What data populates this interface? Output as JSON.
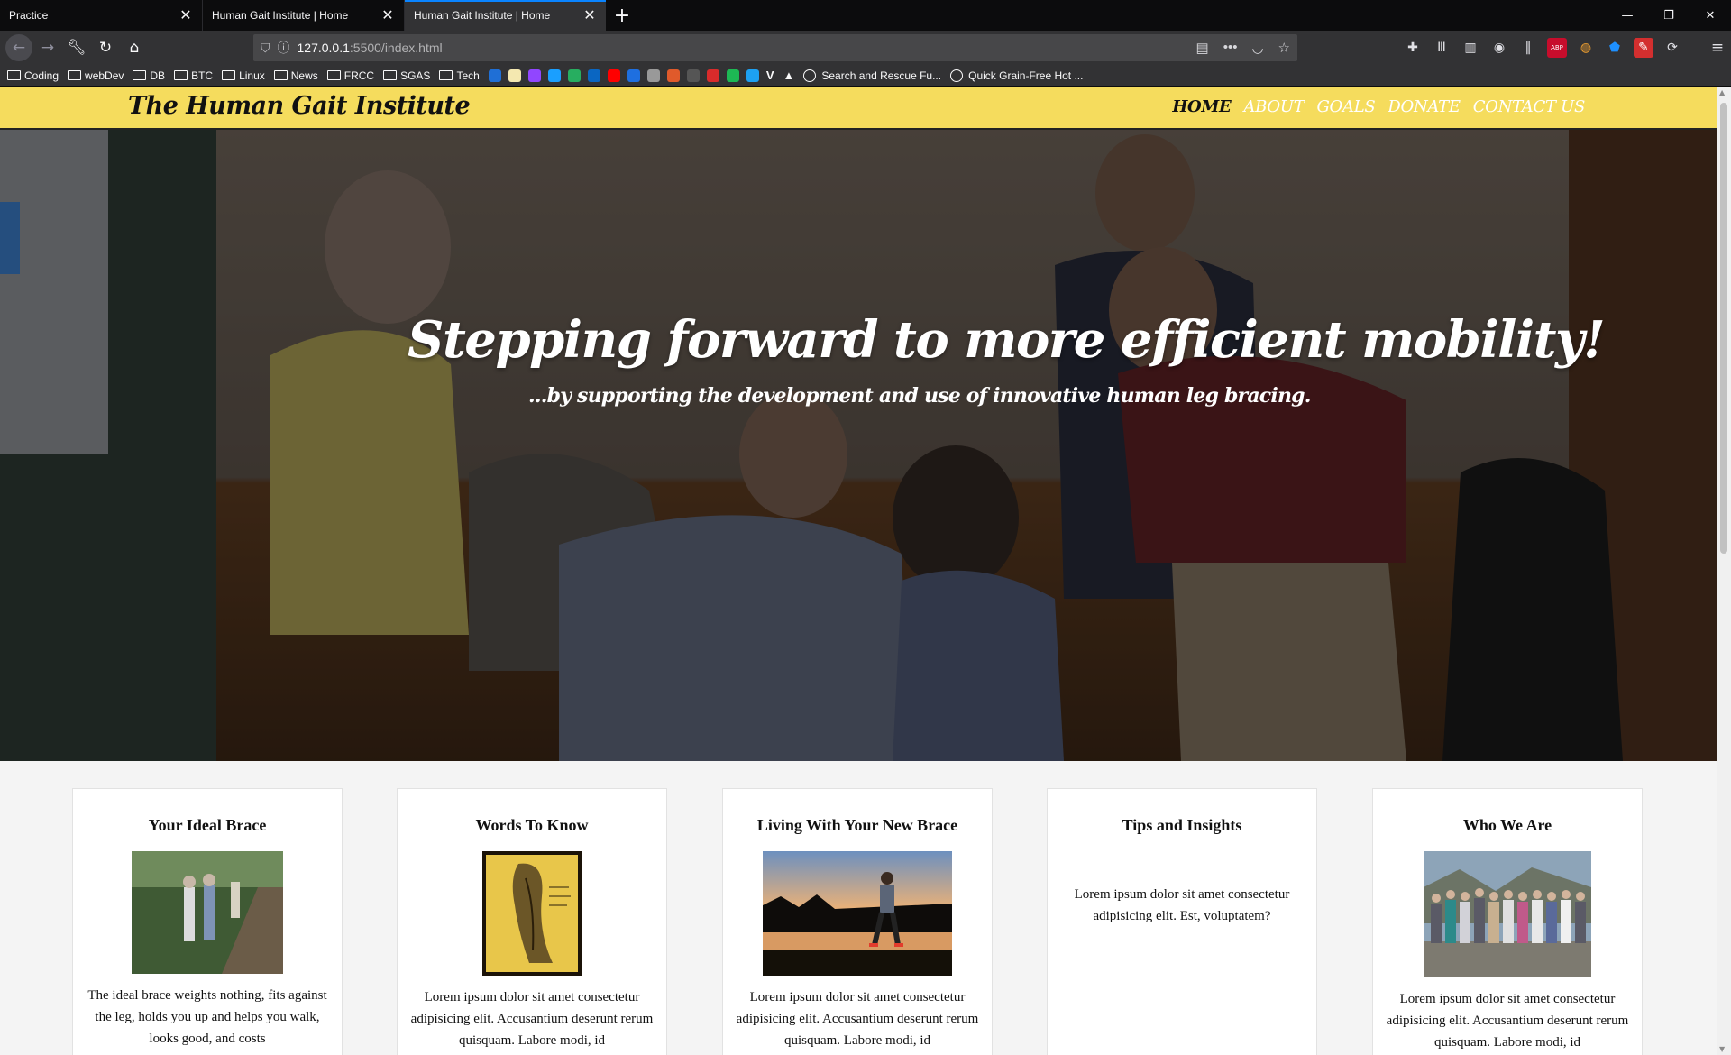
{
  "browser": {
    "tabs": [
      {
        "title": "Practice",
        "active": false
      },
      {
        "title": "Human Gait Institute | Home",
        "active": false
      },
      {
        "title": "Human Gait Institute | Home",
        "active": true
      }
    ],
    "new_tab_symbol": "+",
    "url_host": "127.0.0.1",
    "url_path": ":5500/index.html",
    "bookmarks": [
      {
        "type": "folder",
        "label": "Coding"
      },
      {
        "type": "folder",
        "label": "webDev"
      },
      {
        "type": "folder",
        "label": "DB"
      },
      {
        "type": "folder",
        "label": "BTC"
      },
      {
        "type": "folder",
        "label": "Linux"
      },
      {
        "type": "folder",
        "label": "News"
      },
      {
        "type": "folder",
        "label": "FRCC"
      },
      {
        "type": "folder",
        "label": "SGAS"
      },
      {
        "type": "folder",
        "label": "Tech"
      }
    ],
    "bookmark_favicon_colors": [
      "#1f6fd6",
      "#f4e8b0",
      "#9146ff",
      "#1a9fff",
      "#27ae60",
      "#0a66c2",
      "#ff0000",
      "#1e6fe0",
      "#999999",
      "#e05a2b",
      "#555555",
      "#d92b2b",
      "#1db954",
      "#1da1f2"
    ],
    "bookmark_letter": "V",
    "bookmark_links": [
      {
        "label": "Search and Rescue Fu..."
      },
      {
        "label": "Quick Grain-Free Hot ..."
      }
    ]
  },
  "site": {
    "logo": "The Human Gait Institute",
    "nav": [
      {
        "label": "HOME",
        "current": true
      },
      {
        "label": "ABOUT",
        "current": false
      },
      {
        "label": "GOALS",
        "current": false
      },
      {
        "label": "DONATE",
        "current": false
      },
      {
        "label": "CONTACT US",
        "current": false
      }
    ],
    "hero_title": "Stepping forward to more efficient mobility!",
    "hero_subtitle": "...by supporting the development and use of innovative human leg bracing.",
    "colors": {
      "header": "#f5dc5d",
      "nav_text": "#ffffff",
      "nav_current": "#111111"
    }
  },
  "cards": [
    {
      "title": "Your Ideal Brace",
      "image": "hikers-on-bridge",
      "text": "The ideal brace weights nothing, fits against the leg, holds you up and helps you walk, looks good, and costs"
    },
    {
      "title": "Words To Know",
      "image": "leg-sketch",
      "text": "Lorem ipsum dolor sit amet consectetur adipisicing elit. Accusantium deserunt rerum quisquam. Labore modi, id"
    },
    {
      "title": "Living With Your New Brace",
      "image": "man-walking-sunset",
      "text": "Lorem ipsum dolor sit amet consectetur adipisicing elit. Accusantium deserunt rerum quisquam. Labore modi, id"
    },
    {
      "title": "Tips and Insights",
      "image": "",
      "text": "Lorem ipsum dolor sit amet consectetur adipisicing elit. Est, voluptatem?"
    },
    {
      "title": "Who We Are",
      "image": "group-photo",
      "text": "Lorem ipsum dolor sit amet consectetur adipisicing elit. Accusantium deserunt rerum quisquam. Labore modi, id"
    }
  ]
}
